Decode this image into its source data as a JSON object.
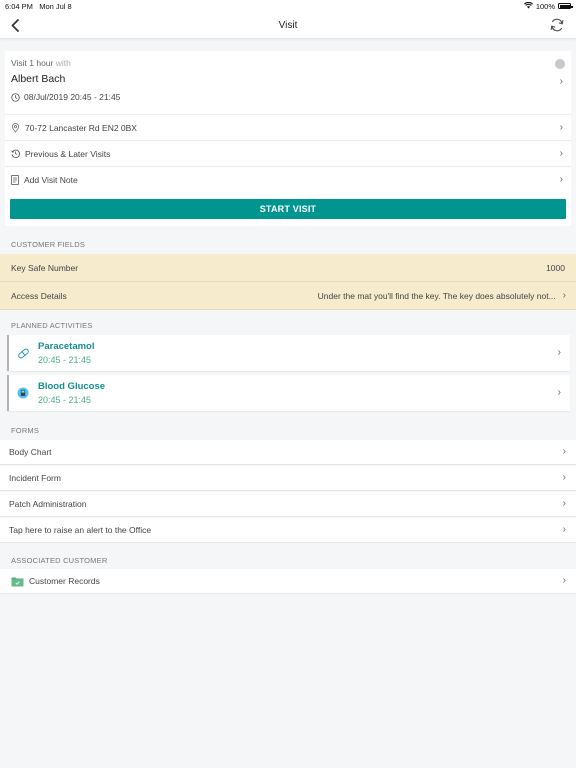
{
  "status_bar": {
    "time": "6:04 PM",
    "date": "Mon Jul 8",
    "battery": "100%"
  },
  "nav": {
    "title": "Visit",
    "back_icon": "chevron-left-icon",
    "refresh_icon": "refresh-icon"
  },
  "visit": {
    "duration_prefix": "Visit 1 hour",
    "duration_suffix": "with",
    "customer_name": "Albert Bach",
    "datetime": "08/Jul/2019  20:45 - 21:45",
    "address": "70-72 Lancaster Rd  EN2 0BX",
    "history_label": "Previous & Later Visits",
    "note_label": "Add Visit Note",
    "start_button": "START VISIT"
  },
  "customer_fields": {
    "header": "CUSTOMER FIELDS",
    "items": [
      {
        "label": "Key Safe Number",
        "value": "1000"
      },
      {
        "label": "Access Details",
        "value": "Under the mat you'll find the key. The key does absolutely not..."
      }
    ]
  },
  "planned_activities": {
    "header": "PLANNED ACTIVITIES",
    "items": [
      {
        "name": "Paracetamol",
        "time": "20:45 - 21:45",
        "icon": "pill-icon"
      },
      {
        "name": "Blood Glucose",
        "time": "20:45 - 21:45",
        "icon": "glucose-meter-icon"
      }
    ]
  },
  "forms": {
    "header": "FORMS",
    "items": [
      {
        "label": "Body Chart"
      },
      {
        "label": "Incident Form"
      },
      {
        "label": "Patch Administration"
      },
      {
        "label": "Tap here to raise an alert to the Office"
      }
    ]
  },
  "associated_customer": {
    "header": "ASSOCIATED CUSTOMER",
    "items": [
      {
        "label": "Customer Records",
        "icon": "folder-check-icon"
      }
    ]
  },
  "colors": {
    "accent": "#00968f",
    "activity_name": "#138f90",
    "activity_time": "#4caf89",
    "customer_field_bg": "#f6ebcd"
  }
}
